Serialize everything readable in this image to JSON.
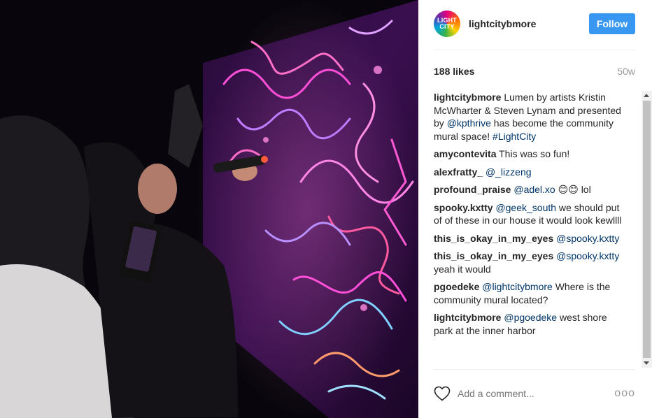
{
  "post": {
    "username": "lightcitybmore",
    "avatar_text": [
      "LIGHT",
      "CITY"
    ],
    "follow_label": "Follow",
    "likes": "188 likes",
    "age": "50w"
  },
  "comments": [
    {
      "user": "lightcitybmore",
      "parts": [
        {
          "t": "text",
          "v": " Lumen by artists Kristin McWharter & Steven Lynam and presented by "
        },
        {
          "t": "mention",
          "v": "@kpthrive"
        },
        {
          "t": "text",
          "v": " has become the community mural space! "
        },
        {
          "t": "mention",
          "v": "#LightCity"
        }
      ]
    },
    {
      "user": "amycontevita",
      "parts": [
        {
          "t": "text",
          "v": " This was so fun!"
        }
      ]
    },
    {
      "user": "alexfratty_",
      "parts": [
        {
          "t": "text",
          "v": " "
        },
        {
          "t": "mention",
          "v": "@_lizzeng"
        }
      ]
    },
    {
      "user": "profound_praise",
      "parts": [
        {
          "t": "text",
          "v": " "
        },
        {
          "t": "mention",
          "v": "@adel.xo"
        },
        {
          "t": "text",
          "v": " 😊😊 lol"
        }
      ]
    },
    {
      "user": "spooky.kxtty",
      "parts": [
        {
          "t": "text",
          "v": " "
        },
        {
          "t": "mention",
          "v": "@geek_south"
        },
        {
          "t": "text",
          "v": " we should put of of these in our house it would look kewllll"
        }
      ]
    },
    {
      "user": "this_is_okay_in_my_eyes",
      "parts": [
        {
          "t": "text",
          "v": " "
        },
        {
          "t": "mention",
          "v": "@spooky.kxtty"
        }
      ]
    },
    {
      "user": "this_is_okay_in_my_eyes",
      "parts": [
        {
          "t": "text",
          "v": " "
        },
        {
          "t": "mention",
          "v": "@spooky.kxtty"
        },
        {
          "t": "text",
          "v": " yeah it would"
        }
      ]
    },
    {
      "user": "pgoedeke",
      "parts": [
        {
          "t": "text",
          "v": " "
        },
        {
          "t": "mention",
          "v": "@lightcitybmore"
        },
        {
          "t": "text",
          "v": " Where is the community mural located?"
        }
      ]
    },
    {
      "user": "lightcitybmore",
      "parts": [
        {
          "t": "text",
          "v": " "
        },
        {
          "t": "mention",
          "v": "@pgoedeke"
        },
        {
          "t": "text",
          "v": " west shore park at the inner harbor"
        }
      ]
    }
  ],
  "add_comment": {
    "placeholder": "Add a comment...",
    "more_label": "ooo"
  },
  "icons": {
    "like": "heart-icon",
    "more": "more-options-icon"
  },
  "colors": {
    "follow": "#3897f0",
    "mention": "#003569",
    "muted": "#999999"
  }
}
